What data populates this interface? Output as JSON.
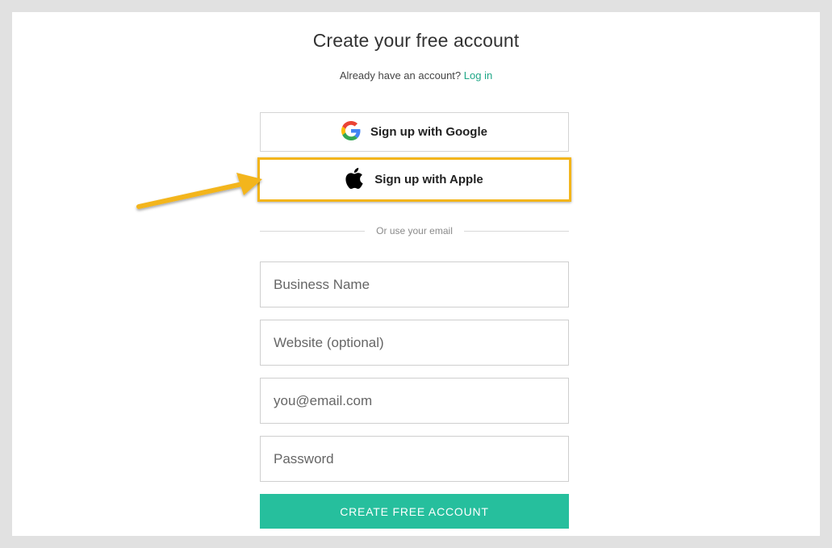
{
  "page": {
    "title": "Create your free account",
    "login_prompt": "Already have an account?",
    "login_link": "Log in"
  },
  "social": {
    "google_label": "Sign up with Google",
    "apple_label": "Sign up with Apple"
  },
  "divider": {
    "text": "Or use your email"
  },
  "form": {
    "business_name_placeholder": "Business Name",
    "website_placeholder": "Website (optional)",
    "email_placeholder": "you@email.com",
    "password_placeholder": "Password",
    "submit_label": "CREATE FREE ACCOUNT"
  },
  "colors": {
    "accent_green": "#26bf9d",
    "link_green": "#1fa787",
    "highlight_yellow": "#f3b51b"
  },
  "icons": {
    "google": "google-logo-icon",
    "apple": "apple-logo-icon",
    "annotation": "annotation-arrow-icon"
  }
}
